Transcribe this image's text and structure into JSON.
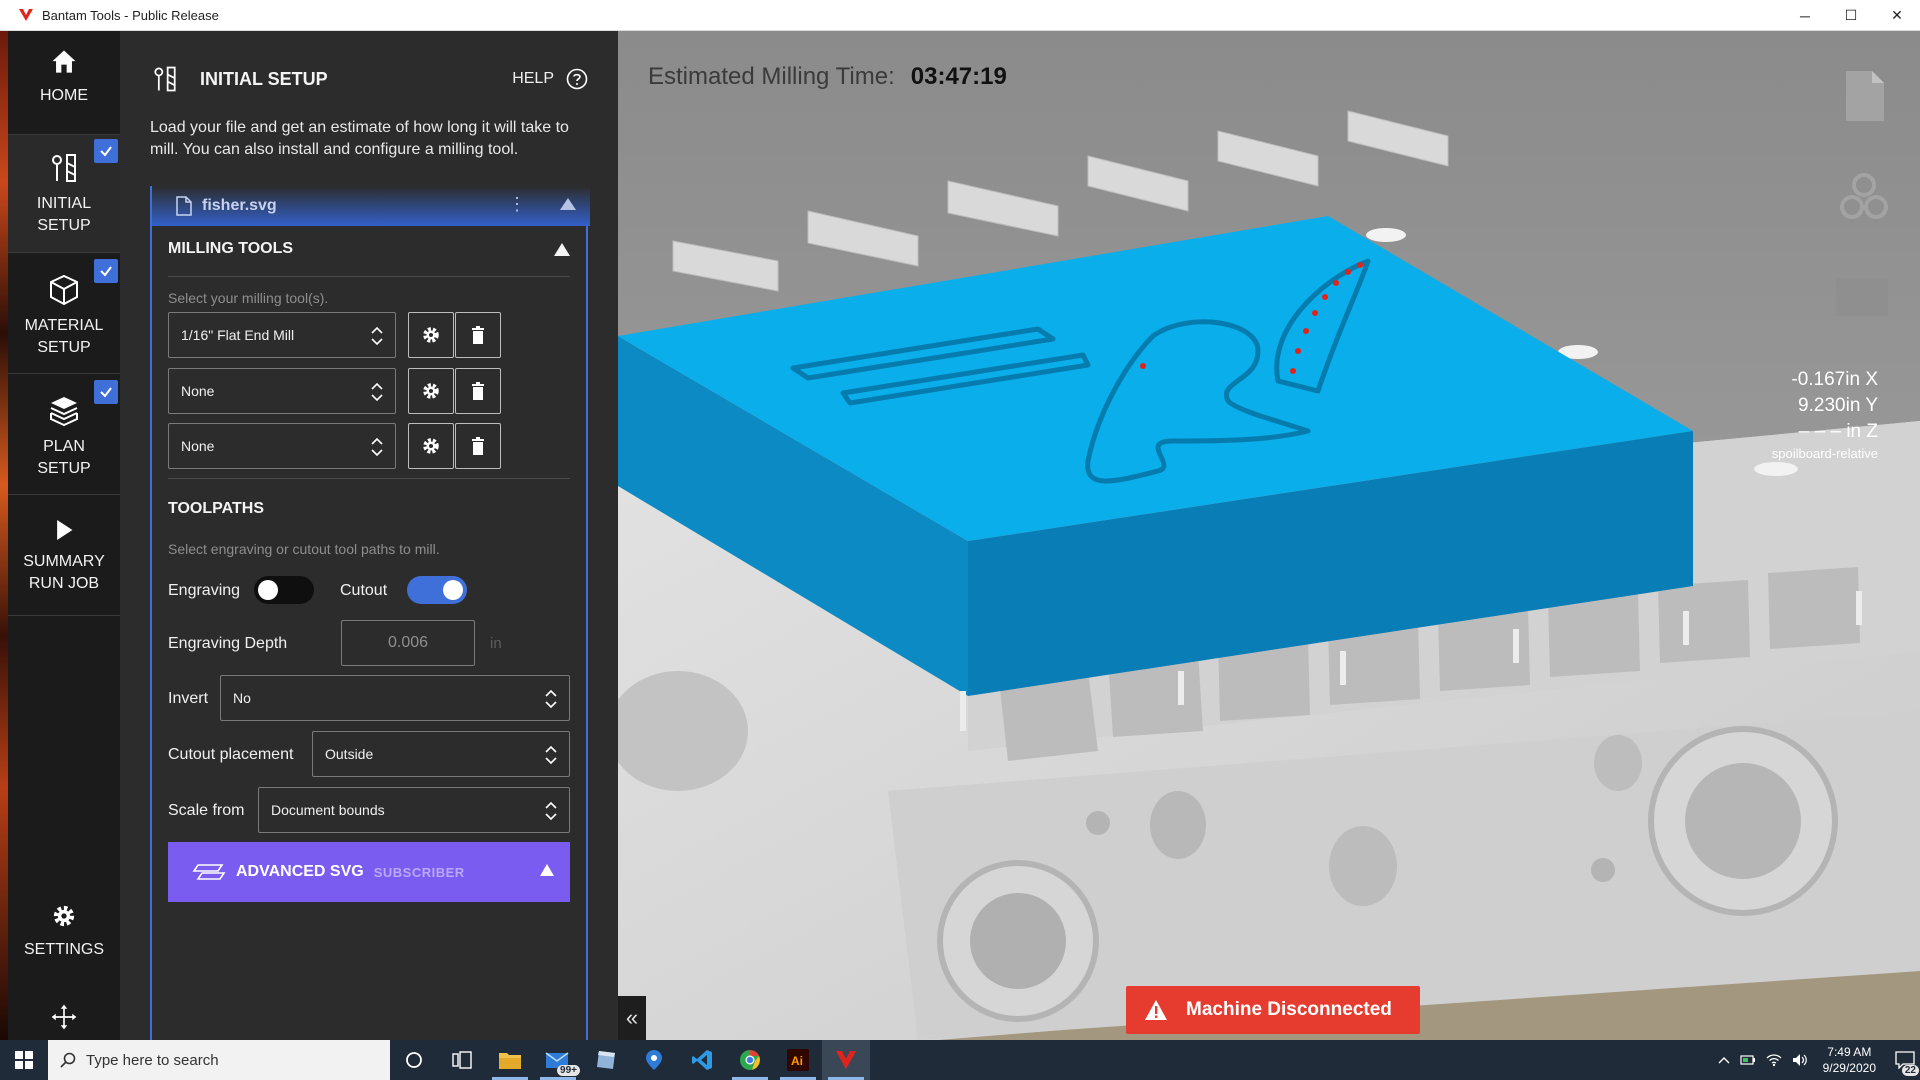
{
  "window": {
    "title": "Bantam Tools - Public Release",
    "minimize": "─",
    "maximize": "☐",
    "close": "✕"
  },
  "nav": {
    "home": "HOME",
    "initial_setup": [
      "INITIAL",
      "SETUP"
    ],
    "material_setup": [
      "MATERIAL",
      "SETUP"
    ],
    "plan_setup": [
      "PLAN",
      "SETUP"
    ],
    "summary": [
      "SUMMARY",
      "RUN JOB"
    ],
    "settings": "SETTINGS"
  },
  "panel": {
    "title": "INITIAL SETUP",
    "help": "HELP",
    "description": "Load your file and get an estimate of how long it will take to mill. You can also install and configure a milling tool.",
    "file_name": "fisher.svg",
    "kebab": "⋮",
    "milling_tools": {
      "title": "MILLING TOOLS",
      "hint": "Select your milling tool(s).",
      "tools": [
        "1/16\" Flat End Mill",
        "None",
        "None"
      ]
    },
    "toolpaths": {
      "title": "TOOLPATHS",
      "hint": "Select engraving or cutout tool paths to mill.",
      "engraving_label": "Engraving",
      "engraving_on": false,
      "cutout_label": "Cutout",
      "cutout_on": true,
      "depth_label": "Engraving Depth",
      "depth_value": "0.006",
      "depth_unit": "in",
      "invert_label": "Invert",
      "invert_value": "No",
      "placement_label": "Cutout placement",
      "placement_value": "Outside",
      "scale_label": "Scale from",
      "scale_value": "Document bounds"
    },
    "advanced": {
      "label": "ADVANCED SVG",
      "badge": "SUBSCRIBER"
    }
  },
  "viewport": {
    "estimate_label": "Estimated Milling Time:",
    "estimate_value": "03:47:19",
    "coord_x": "-0.167in X",
    "coord_y": "9.230in Y",
    "coord_z": "– – – in Z",
    "coord_ref": "spoilboard-relative",
    "collapse": "«",
    "status": "Machine Disconnected"
  },
  "taskbar": {
    "search_placeholder": "Type here to search",
    "mail_badge": "99+",
    "time": "7:49 AM",
    "date": "9/29/2020",
    "notifications": "22"
  },
  "colors": {
    "accent": "#3f6fd8",
    "advanced": "#7b5cf0",
    "error": "#e63c30",
    "material": "#0aa8e8"
  }
}
